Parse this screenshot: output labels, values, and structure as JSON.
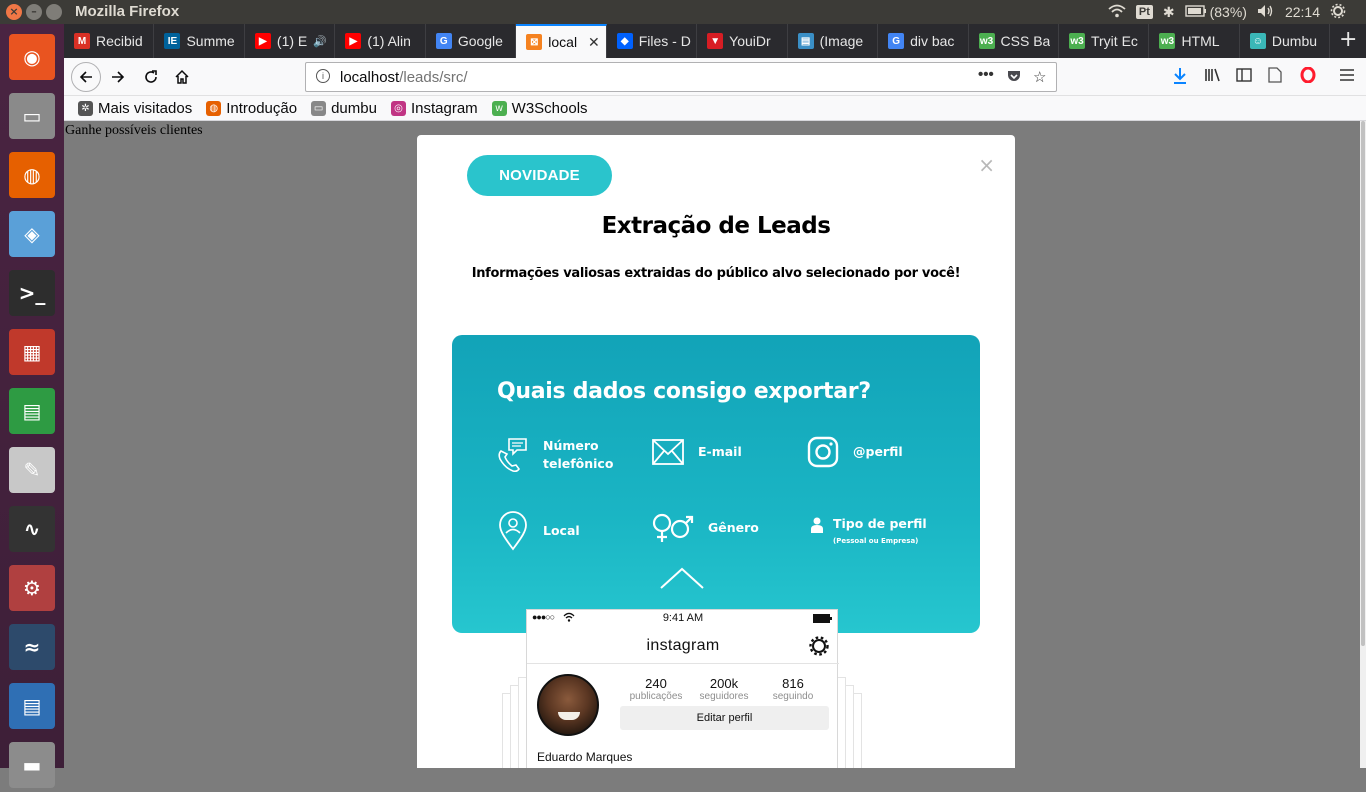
{
  "system": {
    "window_title": "Mozilla Firefox",
    "keyboard_layout": "Pt",
    "battery": "(83%)",
    "time": "22:14"
  },
  "launcher": {
    "items": [
      {
        "name": "ubuntu-dash",
        "color": "#e95420"
      },
      {
        "name": "files",
        "color": "#8a8a8a"
      },
      {
        "name": "firefox",
        "color": "#e66000"
      },
      {
        "name": "virtualbox",
        "color": "#5aa0d8"
      },
      {
        "name": "terminal",
        "color": "#2d2d2d"
      },
      {
        "name": "app-grid",
        "color": "#c0392b"
      },
      {
        "name": "calc",
        "color": "#2e9b43"
      },
      {
        "name": "text-editor",
        "color": "#c8c8c8"
      },
      {
        "name": "system-monitor",
        "color": "#333333"
      },
      {
        "name": "system-settings",
        "color": "#b04040"
      },
      {
        "name": "mysql-workbench",
        "color": "#2d4a6b"
      },
      {
        "name": "writer",
        "color": "#2f6fb4"
      },
      {
        "name": "disk",
        "color": "#8c8c8c"
      }
    ]
  },
  "tabs": [
    {
      "label": "Recibid",
      "fav": "M",
      "color": "#d93025"
    },
    {
      "label": "Summe",
      "fav": "IE",
      "color": "#00629b"
    },
    {
      "label": "(1) E",
      "fav": "▶",
      "color": "#ff0000",
      "audio": true
    },
    {
      "label": "(1) Alin",
      "fav": "▶",
      "color": "#ff0000"
    },
    {
      "label": "Google",
      "fav": "G",
      "color": "#4285f4"
    },
    {
      "label": "local",
      "fav": "⊠",
      "color": "#f58220",
      "active": true
    },
    {
      "label": "Files - D",
      "fav": "◆",
      "color": "#0061fe"
    },
    {
      "label": "YouiDr",
      "fav": "▼",
      "color": "#d71d24"
    },
    {
      "label": "(Image",
      "fav": "▤",
      "color": "#3a8fc6"
    },
    {
      "label": "div bac",
      "fav": "G",
      "color": "#4285f4"
    },
    {
      "label": "CSS Ba",
      "fav": "w3",
      "color": "#4caf50"
    },
    {
      "label": "Tryit Ec",
      "fav": "w3",
      "color": "#4caf50"
    },
    {
      "label": "HTML",
      "fav": "w3",
      "color": "#4caf50"
    },
    {
      "label": "Dumbu",
      "fav": "☺",
      "color": "#3ab7b7"
    }
  ],
  "nav": {
    "url_host": "localhost",
    "url_path": "/leads/src/"
  },
  "bookmarks": [
    {
      "label": "Mais visitados",
      "icon": "gear-icon",
      "color": "#555555"
    },
    {
      "label": "Introdução",
      "icon": "firefox-icon",
      "color": "#e66000"
    },
    {
      "label": "dumbu",
      "icon": "folder-icon",
      "color": "#888888"
    },
    {
      "label": "Instagram",
      "icon": "instagram-icon",
      "color": "#c13584"
    },
    {
      "label": "W3Schools",
      "icon": "w3-icon",
      "color": "#4caf50"
    }
  ],
  "page": {
    "text": "Ganhe possíveis clientes"
  },
  "modal": {
    "badge": "NOVIDADE",
    "close": "×",
    "title": "Extração de Leads",
    "subtitle": "Informações valiosas extraidas do público alvo selecionado por você!",
    "card_title": "Quais dados consigo exportar?",
    "features": [
      {
        "label": "Número telefônico",
        "line1": "Número",
        "line2": "telefônico",
        "icon": "phone-chat-icon"
      },
      {
        "label": "E-mail",
        "icon": "envelope-icon"
      },
      {
        "label": "@perfil",
        "icon": "instagram-icon"
      },
      {
        "label": "Local",
        "icon": "location-pin-icon"
      },
      {
        "label": "Gênero",
        "icon": "gender-icon"
      },
      {
        "label": "Tipo de perfil",
        "note": "(Pessoal ou Empresa)",
        "icon": "person-icon"
      }
    ],
    "accent": "#2ac4cc"
  },
  "phone": {
    "time": "9:41 AM",
    "app": "instagram",
    "stats": [
      {
        "n": "240",
        "l": "publicações"
      },
      {
        "n": "200k",
        "l": "seguidores"
      },
      {
        "n": "816",
        "l": "seguindo"
      }
    ],
    "edit_button": "Editar perfil",
    "username": "Eduardo Marques"
  }
}
